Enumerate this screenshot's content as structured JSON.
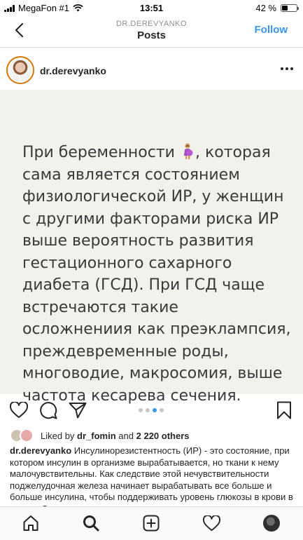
{
  "status_bar": {
    "carrier": "MegaFon #1",
    "time": "13:51",
    "battery": "42 %",
    "battery_level": 0.42
  },
  "nav": {
    "subtitle": "DR.DEREVYANKO",
    "title": "Posts",
    "follow_label": "Follow"
  },
  "post": {
    "username": "dr.derevyanko",
    "image_text_before": "При беременности",
    "image_text_after": ", которая сама является состоянием физиологической ИР, у женщин с другими факторами риска ИР выше вероятность развития гестационного сахарного диабета (ГСД). При ГСД чаще встречаются такие осложнениия как преэклампсия, преждевременные роды, многоводие, макросомия, выше частота кесарева сечения.",
    "carousel_count": 4,
    "carousel_active": 3
  },
  "likes": {
    "prefix": "Liked by",
    "user": "dr_fomin",
    "connector": "and",
    "others": "2 220 others"
  },
  "caption": {
    "username": "dr.derevyanko",
    "text": "Инсулинорезистентность (ИР) - это состояние, при котором инсулин в организме вырабатывается, но ткани к нему малочувствительны. Как следствие этой нечувствительности поджелудочная железа начинает вырабатывать все больше и больше инсулина, чтобы поддерживать уровень глюкозы в крови в норме. Однако со"
  },
  "icons": {
    "back": "chevron-left-icon",
    "more": "more-horizontal-icon",
    "like": "heart-icon",
    "comment": "comment-icon",
    "share": "send-icon",
    "save": "bookmark-icon",
    "home": "home-icon",
    "search": "search-icon",
    "add": "add-post-icon",
    "activity": "heart-icon",
    "profile": "profile-avatar"
  },
  "colors": {
    "accent": "#3897f0",
    "image_background": "#f2f1ec",
    "text": "#262626",
    "muted": "#8e8e8e"
  }
}
